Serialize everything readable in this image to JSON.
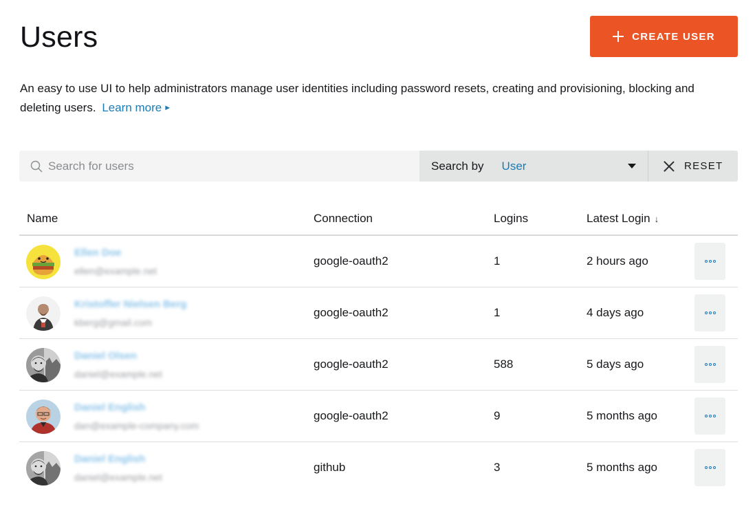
{
  "header": {
    "title": "Users",
    "create_button_label": "CREATE USER"
  },
  "intro": {
    "text": "An easy to use UI to help administrators manage user identities including password resets, creating and provisioning, blocking and deleting users.",
    "learn_more": "Learn more",
    "learn_more_icon": "arrow-icon"
  },
  "search": {
    "placeholder": "Search for users",
    "search_by_label": "Search by",
    "search_by_value": "User",
    "reset_label": "RESET"
  },
  "table": {
    "columns": [
      "Name",
      "Connection",
      "Logins",
      "Latest Login"
    ],
    "sort_indicator": "↓",
    "rows": [
      {
        "name": "Ellen Doe",
        "email": "ellen@example.net",
        "connection": "google-oauth2",
        "logins": "1",
        "latest_login": "2 hours ago"
      },
      {
        "name": "Kristoffer Nielsen Berg",
        "email": "kberg@gmail.com",
        "connection": "google-oauth2",
        "logins": "1",
        "latest_login": "4 days ago"
      },
      {
        "name": "Daniel Olsen",
        "email": "daniel@example.net",
        "connection": "google-oauth2",
        "logins": "588",
        "latest_login": "5 days ago"
      },
      {
        "name": "Daniel English",
        "email": "dan@example-company.com",
        "connection": "google-oauth2",
        "logins": "9",
        "latest_login": "5 months ago"
      },
      {
        "name": "Daniel English",
        "email": "daniel@example.net",
        "connection": "github",
        "logins": "3",
        "latest_login": "5 months ago"
      }
    ]
  },
  "colors": {
    "accent": "#eb5424",
    "link": "#1b7bb5"
  }
}
